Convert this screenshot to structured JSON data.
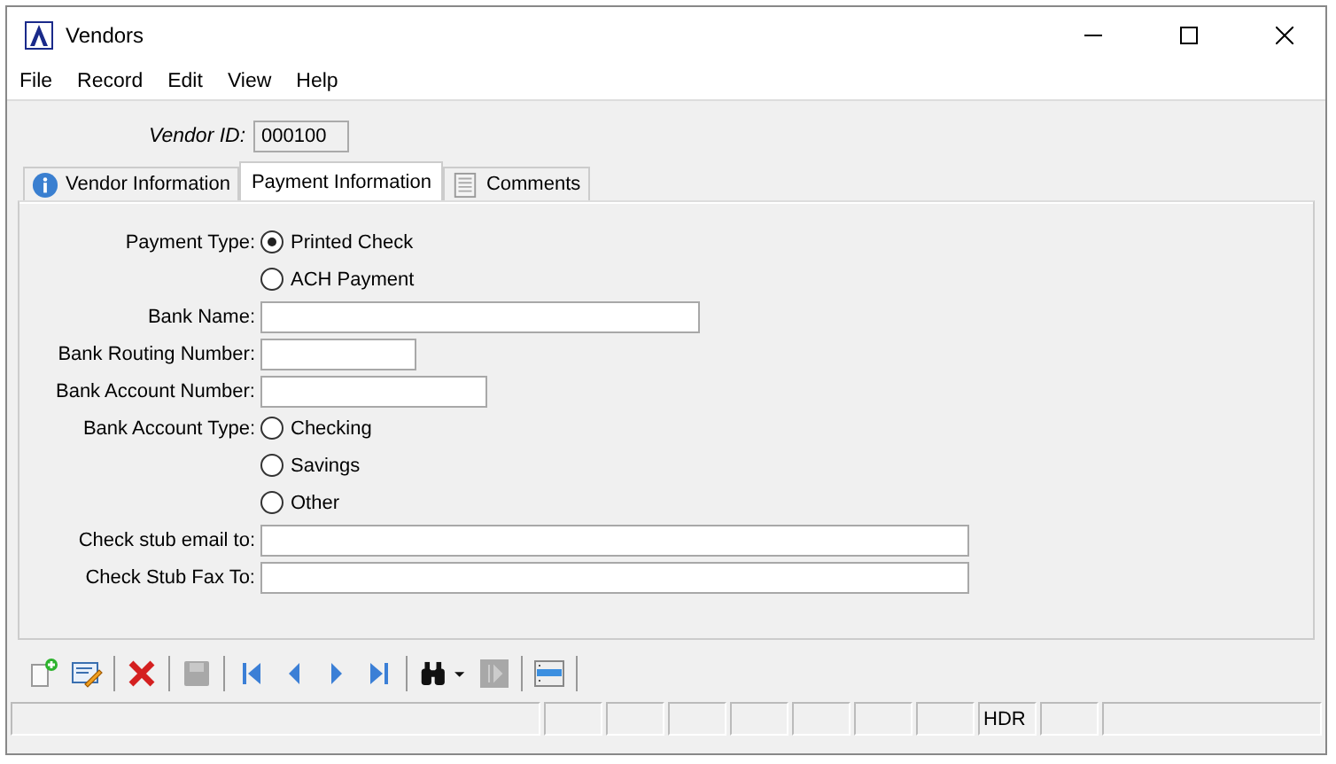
{
  "window": {
    "title": "Vendors"
  },
  "menu": [
    "File",
    "Record",
    "Edit",
    "View",
    "Help"
  ],
  "vendor_id": {
    "label": "Vendor ID:",
    "value": "000100"
  },
  "tabs": [
    {
      "label": "Vendor Information",
      "kind": "info",
      "selected": false
    },
    {
      "label": "Payment Information",
      "kind": "plain",
      "selected": true
    },
    {
      "label": "Comments",
      "kind": "notes",
      "selected": false
    }
  ],
  "form": [
    {
      "label": "Payment Type:",
      "kind": "radio",
      "options": [
        {
          "label": "Printed Check",
          "selected": true
        },
        {
          "label": "ACH Payment",
          "selected": false
        }
      ]
    },
    {
      "label": "Bank Name:",
      "kind": "text"
    },
    {
      "label": "Bank Routing Number:",
      "kind": "text"
    },
    {
      "label": "Bank Account Number:",
      "kind": "text"
    },
    {
      "label": "Bank Account Type:",
      "kind": "radio",
      "options": [
        {
          "label": "Checking",
          "selected": false
        },
        {
          "label": "Savings",
          "selected": false
        },
        {
          "label": "Other",
          "selected": false
        }
      ]
    },
    {
      "label": "Check stub email to:",
      "kind": "text"
    },
    {
      "label": "Check Stub Fax To:",
      "kind": "text"
    }
  ],
  "toolbar": [
    {
      "kind": "new",
      "disabled": false
    },
    {
      "kind": "edit",
      "disabled": false
    },
    {
      "kind": "sep"
    },
    {
      "kind": "delete",
      "disabled": false
    },
    {
      "kind": "sep"
    },
    {
      "kind": "save",
      "disabled": true
    },
    {
      "kind": "sep"
    },
    {
      "kind": "first",
      "disabled": false
    },
    {
      "kind": "prev",
      "disabled": false
    },
    {
      "kind": "next",
      "disabled": false
    },
    {
      "kind": "last",
      "disabled": false
    },
    {
      "kind": "sep"
    },
    {
      "kind": "find",
      "disabled": false
    },
    {
      "kind": "goto",
      "disabled": true
    },
    {
      "kind": "sep"
    },
    {
      "kind": "layout",
      "disabled": false
    },
    {
      "kind": "sep"
    }
  ],
  "status_bar": {
    "mode": "HDR"
  }
}
